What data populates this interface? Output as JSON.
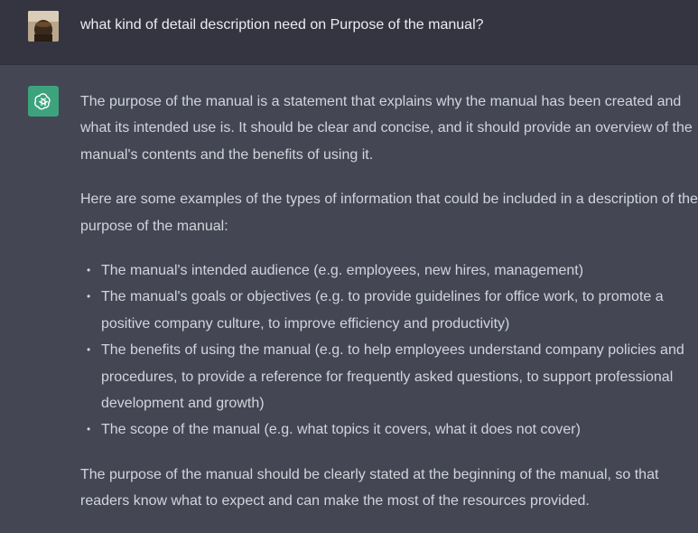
{
  "user_message": {
    "text": "what kind of detail description need on Purpose of the manual?"
  },
  "assistant_message": {
    "paragraphs": [
      "The purpose of the manual is a statement that explains why the manual has been created and what its intended use is. It should be clear and concise, and it should provide an overview of the manual's contents and the benefits of using it.",
      "Here are some examples of the types of information that could be included in a description of the purpose of the manual:"
    ],
    "bullets": [
      "The manual's intended audience (e.g. employees, new hires, management)",
      "The manual's goals or objectives (e.g. to provide guidelines for office work, to promote a positive company culture, to improve efficiency and productivity)",
      "The benefits of using the manual (e.g. to help employees understand company policies and procedures, to provide a reference for frequently asked questions, to support professional development and growth)",
      "The scope of the manual (e.g. what topics it covers, what it does not cover)"
    ],
    "closing": "The purpose of the manual should be clearly stated at the beginning of the manual, so that readers know what to expect and can make the most of the resources provided."
  },
  "icons": {
    "user_avatar": "user-avatar-photo",
    "assistant_avatar": "openai-logo-icon"
  },
  "colors": {
    "user_bg": "#343541",
    "assistant_bg": "#444654",
    "assistant_avatar_bg": "#3ca37d",
    "text": "#d1d5db"
  }
}
